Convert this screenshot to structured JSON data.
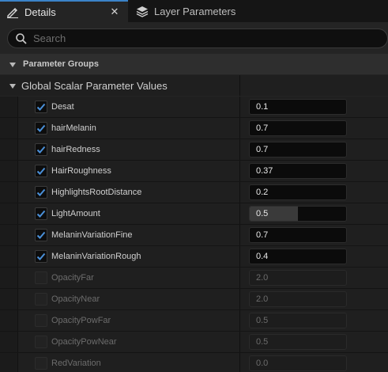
{
  "tabs": [
    {
      "label": "Details",
      "icon": "pencil-ruler-icon",
      "active": true
    },
    {
      "label": "Layer Parameters",
      "icon": "layers-icon",
      "active": false
    }
  ],
  "search": {
    "placeholder": "Search"
  },
  "parameter_groups": {
    "label": "Parameter Groups"
  },
  "group": {
    "label": "Global Scalar Parameter Values"
  },
  "params": [
    {
      "name": "Desat",
      "value": "0.1",
      "checked": true,
      "enabled": true,
      "slider": 0
    },
    {
      "name": "hairMelanin",
      "value": "0.7",
      "checked": true,
      "enabled": true,
      "slider": 0
    },
    {
      "name": "hairRedness",
      "value": "0.7",
      "checked": true,
      "enabled": true,
      "slider": 0
    },
    {
      "name": "HairRoughness",
      "value": "0.37",
      "checked": true,
      "enabled": true,
      "slider": 0
    },
    {
      "name": "HighlightsRootDistance",
      "value": "0.2",
      "checked": true,
      "enabled": true,
      "slider": 0
    },
    {
      "name": "LightAmount",
      "value": "0.5",
      "checked": true,
      "enabled": true,
      "slider": 0.5
    },
    {
      "name": "MelaninVariationFine",
      "value": "0.7",
      "checked": true,
      "enabled": true,
      "slider": 0
    },
    {
      "name": "MelaninVariationRough",
      "value": "0.4",
      "checked": true,
      "enabled": true,
      "slider": 0
    },
    {
      "name": "OpacityFar",
      "value": "2.0",
      "checked": false,
      "enabled": false,
      "slider": 0
    },
    {
      "name": "OpacityNear",
      "value": "2.0",
      "checked": false,
      "enabled": false,
      "slider": 0
    },
    {
      "name": "OpacityPowFar",
      "value": "0.5",
      "checked": false,
      "enabled": false,
      "slider": 0
    },
    {
      "name": "OpacityPowNear",
      "value": "0.5",
      "checked": false,
      "enabled": false,
      "slider": 0
    },
    {
      "name": "RedVariation",
      "value": "0.0",
      "checked": false,
      "enabled": false,
      "slider": 0
    }
  ],
  "colors": {
    "accent": "#3b83c8",
    "checkmark": "#4a90d9"
  }
}
